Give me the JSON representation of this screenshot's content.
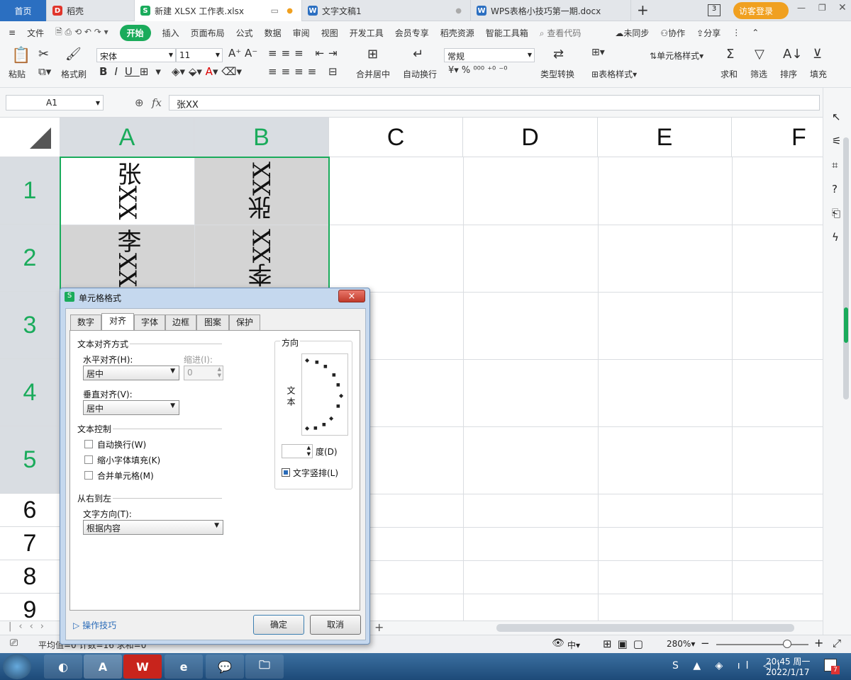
{
  "tabs": [
    {
      "label": "首页"
    },
    {
      "label": "稻壳"
    },
    {
      "label": "新建 XLSX 工作表.xlsx"
    },
    {
      "label": "文字文稿1"
    },
    {
      "label": "WPS表格小技巧第一期.docx"
    }
  ],
  "login": "访客登录",
  "tab_badge": "3",
  "menu": {
    "file": "文件",
    "items": [
      "开始",
      "插入",
      "页面布局",
      "公式",
      "数据",
      "审阅",
      "视图",
      "开发工具",
      "会员专享",
      "稻壳资源",
      "智能工具箱"
    ],
    "search": "查看代码",
    "sync": "未同步",
    "collab": "协作",
    "share": "分享"
  },
  "ribbon": {
    "paste": "粘贴",
    "format_painter": "格式刷",
    "font": "宋体",
    "size": "11",
    "merge": "合并居中",
    "wrap": "自动换行",
    "number_format": "常规",
    "type_convert": "类型转换",
    "cond_format": "条件格式",
    "cell_style": "单元格样式",
    "table_style": "表格样式",
    "sum": "求和",
    "filter": "筛选",
    "sort": "排序",
    "fill": "填充"
  },
  "formula": {
    "cell_ref": "A1",
    "fx": "fx",
    "content": "张XX"
  },
  "grid": {
    "columns": [
      "A",
      "B",
      "C",
      "D",
      "E",
      "F"
    ],
    "rows": [
      "1",
      "2",
      "3",
      "4",
      "5",
      "6",
      "7",
      "8",
      "9"
    ],
    "cells": {
      "A1": "张XX",
      "B1": "张XX",
      "A2": "李XX",
      "B2": "李XX"
    }
  },
  "status": {
    "text": "平均值=0  计数=16  求和=0",
    "zoom": "280%",
    "lang": "中"
  },
  "taskbar": {
    "time": "20:45 周一",
    "date": "2022/1/17",
    "badge": "7"
  },
  "dialog": {
    "title": "单元格格式",
    "close": "×",
    "tabs": [
      "数字",
      "对齐",
      "字体",
      "边框",
      "图案",
      "保护"
    ],
    "sec_align": "文本对齐方式",
    "h_align_label": "水平对齐(H):",
    "h_align_value": "居中",
    "indent_label": "缩进(I):",
    "indent_value": "0",
    "v_align_label": "垂直对齐(V):",
    "v_align_value": "居中",
    "sec_control": "文本控制",
    "wrap": "自动换行(W)",
    "shrink": "缩小字体填充(K)",
    "merge": "合并单元格(M)",
    "sec_rtl": "从右到左",
    "dir_label": "文字方向(T):",
    "dir_value": "根据内容",
    "orient_label": "方向",
    "orient_text": "文本",
    "degree_label": "度(D)",
    "degree_value": "",
    "vertical_text": "文字竖排(L)",
    "tips": "操作技巧",
    "ok": "确定",
    "cancel": "取消"
  }
}
